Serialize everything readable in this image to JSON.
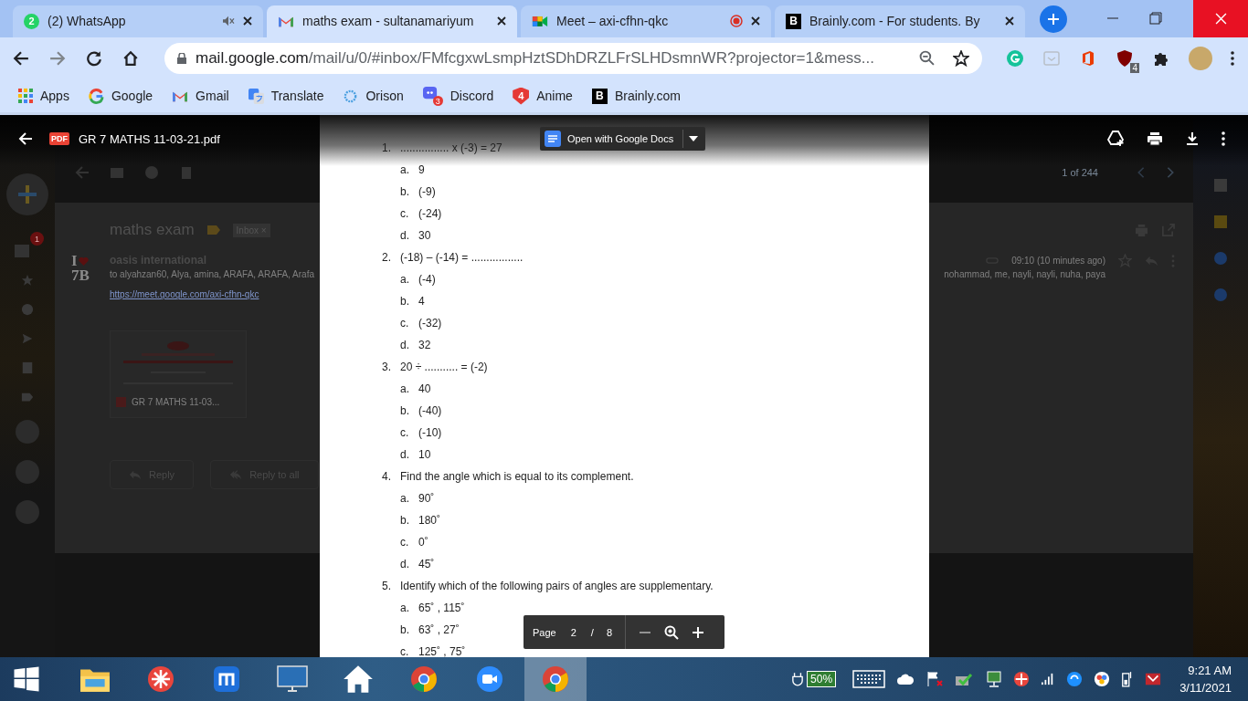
{
  "browser": {
    "tabs": [
      {
        "kind": "whatsapp",
        "favicon_badge": "2",
        "title": "(2) WhatsApp",
        "selected": false,
        "muted": true,
        "recording": false
      },
      {
        "kind": "gmail",
        "title": "maths exam - sultanamariyum",
        "selected": true,
        "muted": false,
        "recording": false
      },
      {
        "kind": "meet",
        "title": "Meet – axi-cfhn-qkc",
        "selected": false,
        "muted": false,
        "recording": true
      },
      {
        "kind": "brainly",
        "favicon_text": "B",
        "title": "Brainly.com - For students. By",
        "selected": false,
        "muted": false,
        "recording": false
      }
    ],
    "address": {
      "host": "mail.google.com",
      "path": "/mail/u/0/#inbox/FMfcgxwLsmpHztSDhDRZLFrSLHDsmnWR?projector=1&mess..."
    },
    "extension_badge": "4",
    "bookmarks": [
      {
        "kind": "apps",
        "label": "Apps"
      },
      {
        "kind": "google",
        "label": "Google"
      },
      {
        "kind": "gmail",
        "label": "Gmail"
      },
      {
        "kind": "translate",
        "label": "Translate"
      },
      {
        "kind": "orison",
        "label": "Orison"
      },
      {
        "kind": "discord",
        "label": "Discord",
        "badge": "3"
      },
      {
        "kind": "anime",
        "label": "Anime",
        "icon_text": "4"
      },
      {
        "kind": "brainly",
        "label": "Brainly.com",
        "icon_text": "B"
      }
    ]
  },
  "gmail": {
    "pagination": "1 of 244",
    "unread_badge": "1",
    "subject": "maths exam",
    "label": "Inbox",
    "label_remove": "×",
    "sender_logo": {
      "line_1": "I",
      "line_2": "7B"
    },
    "sender": "oasis international",
    "recipients": "to alyahzan60, Alya, amina, ARAFA, ARAFA, Arafa",
    "recipients_end": "nohammad, me, nayli, nayli, nuha, paya",
    "time": "09:10 (10 minutes ago)",
    "link": "https://meet.google.com/axi-cfhn-qkc",
    "attachment": "GR 7 MATHS 11-03...",
    "actions": [
      "Reply",
      "Reply to all"
    ]
  },
  "pdf_viewer": {
    "file_badge": "PDF",
    "title": "GR 7 MATHS 11-03-21.pdf",
    "open_with": "Open with Google Docs",
    "questions": [
      {
        "number": "1.",
        "text": "................ x (-3) = 27",
        "options": [
          {
            "letter": "a.",
            "text": "9"
          },
          {
            "letter": "b.",
            "text": "(-9)"
          },
          {
            "letter": "c.",
            "text": "(-24)"
          },
          {
            "letter": "d.",
            "text": "30"
          }
        ]
      },
      {
        "number": "2.",
        "text": "(-18) – (-14) = .................",
        "options": [
          {
            "letter": "a.",
            "text": "(-4)"
          },
          {
            "letter": "b.",
            "text": "4"
          },
          {
            "letter": "c.",
            "text": "(-32)"
          },
          {
            "letter": "d.",
            "text": "32"
          }
        ]
      },
      {
        "number": "3.",
        "text": "20 ÷ ........... = (-2)",
        "options": [
          {
            "letter": "a.",
            "text": "40"
          },
          {
            "letter": "b.",
            "text": "(-40)"
          },
          {
            "letter": "c.",
            "text": "(-10)"
          },
          {
            "letter": "d.",
            "text": "10"
          }
        ]
      },
      {
        "number": "4.",
        "text": "Find the angle which is equal to its complement.",
        "options": [
          {
            "letter": "a.",
            "text": "90˚"
          },
          {
            "letter": "b.",
            "text": "180˚"
          },
          {
            "letter": "c.",
            "text": "0˚"
          },
          {
            "letter": "d.",
            "text": "45˚"
          }
        ]
      },
      {
        "number": "5.",
        "text": "Identify which of the following pairs of angles are supplementary.",
        "options": [
          {
            "letter": "a.",
            "text": "65˚ , 115˚"
          },
          {
            "letter": "b.",
            "text": "63˚ , 27˚"
          },
          {
            "letter": "c.",
            "text": "125˚ , 75˚"
          }
        ]
      }
    ],
    "page_label": "Page",
    "page": "2",
    "page_separator": "/",
    "page_count": "8"
  },
  "taskbar": {
    "apps": [
      {
        "kind": "explorer",
        "selected": false
      },
      {
        "kind": "red-app",
        "selected": false
      },
      {
        "kind": "maxthon",
        "selected": false
      },
      {
        "kind": "monitor",
        "selected": false
      },
      {
        "kind": "home",
        "selected": false
      },
      {
        "kind": "chrome",
        "selected": false
      },
      {
        "kind": "zoom",
        "selected": false
      },
      {
        "kind": "chrome",
        "selected": true
      }
    ],
    "battery": "50%",
    "time": "9:21 AM",
    "date": "3/11/2021"
  }
}
